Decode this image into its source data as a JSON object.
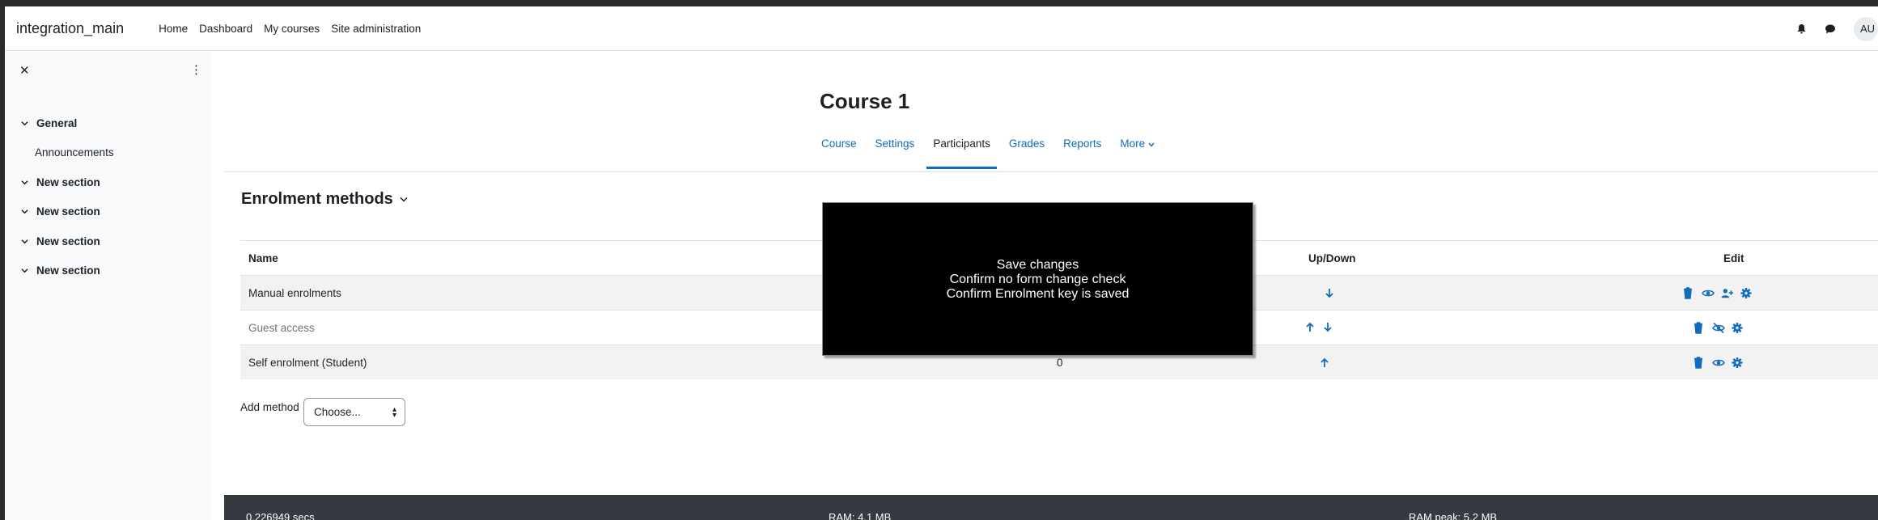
{
  "navbar": {
    "brand": "integration_main",
    "links": [
      "Home",
      "Dashboard",
      "My courses",
      "Site administration"
    ],
    "avatar": "AU",
    "icons": [
      "bell-icon",
      "chat-icon"
    ]
  },
  "drawer": {
    "items": [
      {
        "label": "General",
        "type": "section"
      },
      {
        "label": "Announcements",
        "type": "child"
      },
      {
        "label": "New section",
        "type": "section"
      },
      {
        "label": "New section",
        "type": "section"
      },
      {
        "label": "New section",
        "type": "section"
      },
      {
        "label": "New section",
        "type": "section"
      }
    ]
  },
  "course": {
    "title": "Course 1",
    "tabs": [
      "Course",
      "Settings",
      "Participants",
      "Grades",
      "Reports",
      "More"
    ],
    "active_tab": "Participants"
  },
  "page": {
    "heading": "Enrolment methods",
    "table": {
      "headers": {
        "name": "Name",
        "updown": "Up/Down",
        "edit": "Edit"
      },
      "rows": [
        {
          "name": "Manual enrolments",
          "users": "",
          "muted": false
        },
        {
          "name": "Guest access",
          "users": "",
          "muted": true
        },
        {
          "name": "Self enrolment (Student)",
          "users": "0",
          "muted": false
        }
      ]
    },
    "add_method_label": "Add method",
    "add_method_select": "Choose..."
  },
  "overlay": {
    "lines": [
      "Save changes",
      "Confirm no form change check",
      "Confirm Enrolment key is saved"
    ]
  },
  "footer": {
    "time": "0.226949 secs",
    "ram": "RAM: 4.1 MB",
    "ram_peak": "RAM peak: 5.2 MB"
  },
  "colors": {
    "link": "#0f6cbf",
    "footer_bg": "#343a40",
    "overlay_bg": "#000000"
  }
}
